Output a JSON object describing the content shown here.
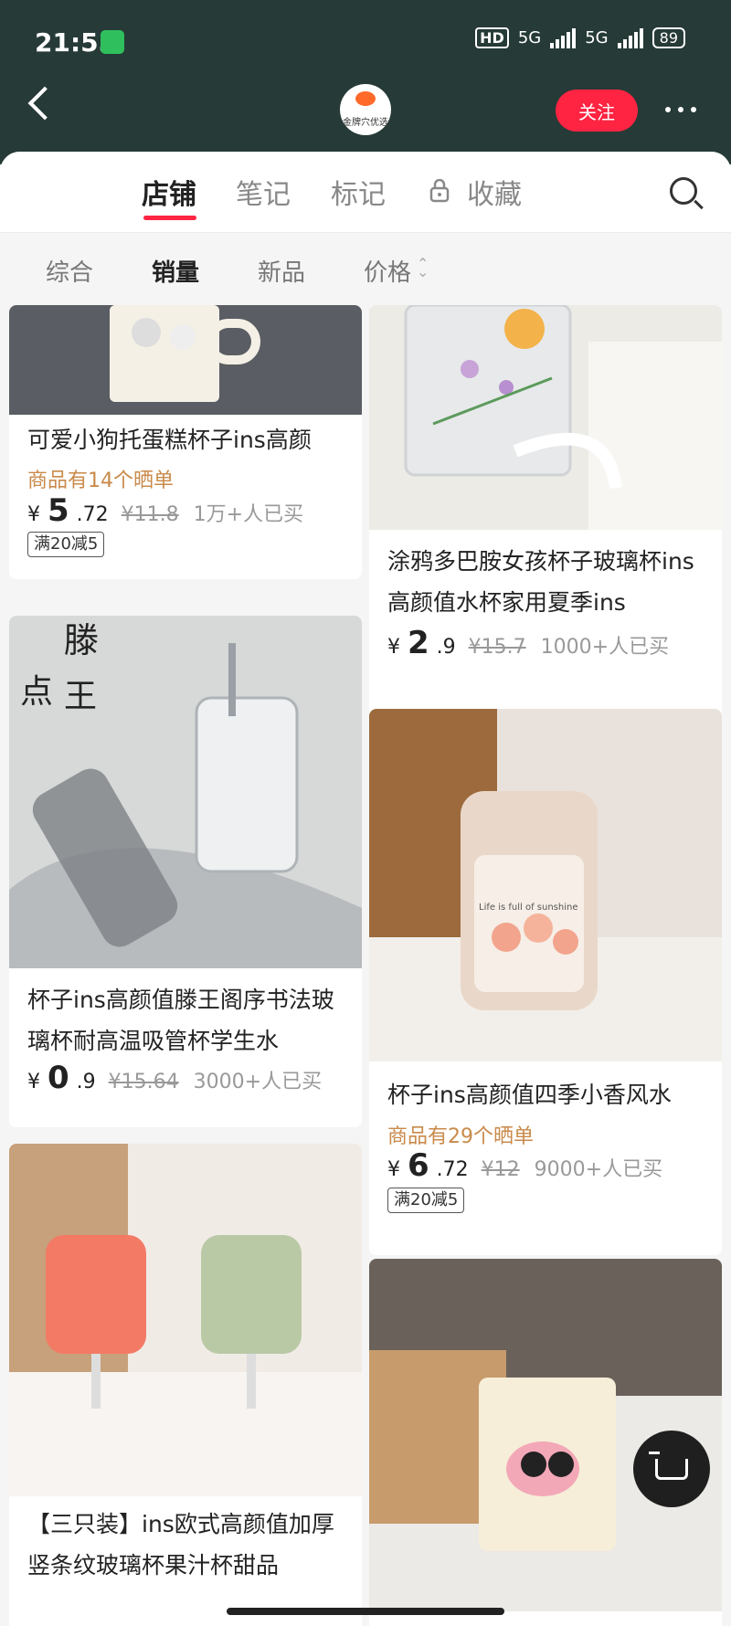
{
  "status": {
    "time": "21:55",
    "hd": "HD",
    "net1": "5G",
    "net2": "5G",
    "battery": "89"
  },
  "header": {
    "shop_logo_text": "金牌穴优选",
    "follow": "关注"
  },
  "tabs": [
    "店铺",
    "笔记",
    "标记",
    "收藏"
  ],
  "filters": [
    "综合",
    "销量",
    "新品",
    "价格"
  ],
  "colors": {
    "brand": "#ff2442",
    "header_bg": "#263a37",
    "review": "#c98a4b"
  },
  "products": [
    {
      "title": "可爱小狗托蛋糕杯子ins高颜",
      "review": "商品有14个晒单",
      "yen": "¥",
      "price_int": "5",
      "price_dec": ".72",
      "orig": "¥11.8",
      "sold": "1万+人已买",
      "coupon": "满20减5"
    },
    {
      "title": "涂鸦多巴胺女孩杯子玻璃杯ins高颜值水杯家用夏季ins",
      "yen": "¥",
      "price_int": "2",
      "price_dec": ".9",
      "orig": "¥15.7",
      "sold": "1000+人已买"
    },
    {
      "title": "杯子ins高颜值滕王阁序书法玻璃杯耐高温吸管杯学生水",
      "yen": "¥",
      "price_int": "0",
      "price_dec": ".9",
      "orig": "¥15.64",
      "sold": "3000+人已买"
    },
    {
      "title": "杯子ins高颜值四季小香风水",
      "review": "商品有29个晒单",
      "yen": "¥",
      "price_int": "6",
      "price_dec": ".72",
      "orig": "¥12",
      "sold": "9000+人已买",
      "coupon": "满20减5"
    },
    {
      "title": "【三只装】ins欧式高颜值加厚竖条纹玻璃杯果汁杯甜品"
    },
    {
      "title": ""
    }
  ],
  "images": {
    "p1": "Life is full of sunshine"
  }
}
